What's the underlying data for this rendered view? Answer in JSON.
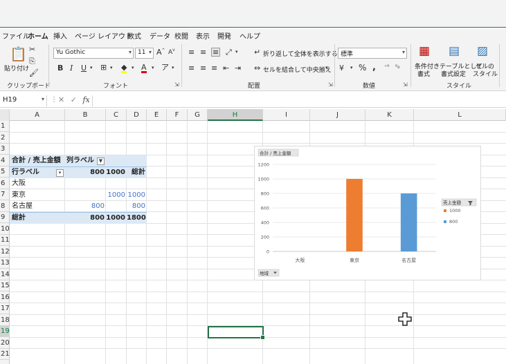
{
  "menubar": {
    "tabs": [
      "ファイル",
      "ホーム",
      "挿入",
      "ページ レイアウト",
      "数式",
      "データ",
      "校閲",
      "表示",
      "開発",
      "ヘルプ"
    ],
    "active_tab": "ホーム"
  },
  "ribbon": {
    "clipboard": {
      "label": "クリップボード",
      "paste": "貼り付け"
    },
    "font": {
      "label": "フォント",
      "font_name": "Yu Gothic",
      "font_size": "11"
    },
    "alignment": {
      "label": "配置",
      "wrap_text": "折り返して全体を表示する",
      "merge_center": "セルを結合して中央揃え"
    },
    "number": {
      "label": "数値",
      "format": "標準"
    },
    "styles": {
      "label": "スタイル",
      "conditional": [
        "条件付き",
        "書式"
      ],
      "table": [
        "テーブルとして",
        "書式設定"
      ],
      "cell": [
        "セルの",
        "スタイル"
      ]
    }
  },
  "formula_bar": {
    "name_box": "H19",
    "fx": "fx",
    "content": ""
  },
  "columns": [
    "A",
    "B",
    "C",
    "D",
    "E",
    "F",
    "G",
    "H",
    "I",
    "J",
    "K",
    "L"
  ],
  "selected_column": "H",
  "rows": [
    "1",
    "2",
    "3",
    "4",
    "5",
    "6",
    "7",
    "8",
    "9",
    "10",
    "11",
    "12",
    "13",
    "14",
    "15",
    "16",
    "17",
    "18",
    "19",
    "20",
    "21"
  ],
  "selected_row": "19",
  "pivot": {
    "header_value": "合計 / 売上金額",
    "col_label": "列ラベル",
    "row_label": "行ラベル",
    "col_800": "800",
    "col_1000": "1000",
    "col_total": "総計",
    "rows": [
      {
        "label": "大阪",
        "v800": "",
        "v1000": "",
        "total": ""
      },
      {
        "label": "東京",
        "v800": "",
        "v1000": "1000",
        "total": "1000"
      },
      {
        "label": "名古屋",
        "v800": "800",
        "v1000": "",
        "total": "800"
      }
    ],
    "grand_label": "総計",
    "grand_800": "800",
    "grand_1000": "1000",
    "grand_total": "1800"
  },
  "chart_data": {
    "type": "bar",
    "value_field": "合計 / 売上金額",
    "categories": [
      "大阪",
      "東京",
      "名古屋"
    ],
    "series": [
      {
        "name": "1000",
        "color": "#ed7d31",
        "values": [
          0,
          1000,
          0
        ]
      },
      {
        "name": "800",
        "color": "#5b9bd5",
        "values": [
          0,
          0,
          800
        ]
      }
    ],
    "legend_title": "売上金額",
    "legend_position": "right",
    "axis_field": "地域",
    "ylim": [
      0,
      1200
    ],
    "yticks": [
      0,
      200,
      400,
      600,
      800,
      1000,
      1200
    ],
    "grid": true
  }
}
